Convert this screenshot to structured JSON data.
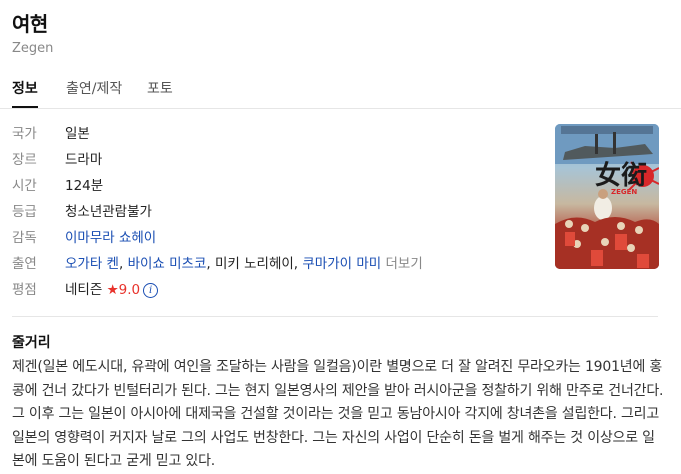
{
  "header": {
    "title": "여현",
    "subtitle": "Zegen"
  },
  "tabs": [
    {
      "label": "정보",
      "active": true
    },
    {
      "label": "출연/제작",
      "active": false
    },
    {
      "label": "포토",
      "active": false
    }
  ],
  "info": {
    "country": {
      "label": "국가",
      "value": "일본"
    },
    "genre": {
      "label": "장르",
      "value": "드라마"
    },
    "runtime": {
      "label": "시간",
      "value": "124분"
    },
    "rating": {
      "label": "등급",
      "value": "청소년관람불가"
    },
    "director": {
      "label": "감독",
      "value": "이마무라 쇼헤이"
    },
    "cast": {
      "label": "출연",
      "members": [
        "오가타 켄",
        "바이쇼 미츠코",
        "미키 노리헤이",
        "쿠마가이 마미"
      ],
      "separator": ", ",
      "more": "더보기"
    },
    "score": {
      "label": "평점",
      "source": "네티즌",
      "star": "★",
      "value": "9.0",
      "info_icon": "i"
    }
  },
  "poster": {
    "title_glyphs": "女衒",
    "subtitle": "ZEGEN"
  },
  "synopsis": {
    "heading": "줄거리",
    "text": "제겐(일본 에도시대, 유곽에 여인을 조달하는 사람을 일컬음)이란 별명으로 더 잘 알려진 무라오카는 1901년에 홍콩에 건너 갔다가 빈털터리가 된다. 그는 현지 일본영사의 제안을 받아 러시아군을 정찰하기 위해 만주로 건너간다. 그 이후 그는 일본이 아시아에 대제국을 건설할 것이라는 것을 믿고 동남아시아 각지에 창녀촌을 설립한다. 그리고 일본의 영향력이 커지자 날로 그의 사업도 번창한다. 그는 자신의 사업이 단순히 돈을 벌게 해주는 것 이상으로 일본에 도움이 된다고 굳게 믿고 있다."
  }
}
